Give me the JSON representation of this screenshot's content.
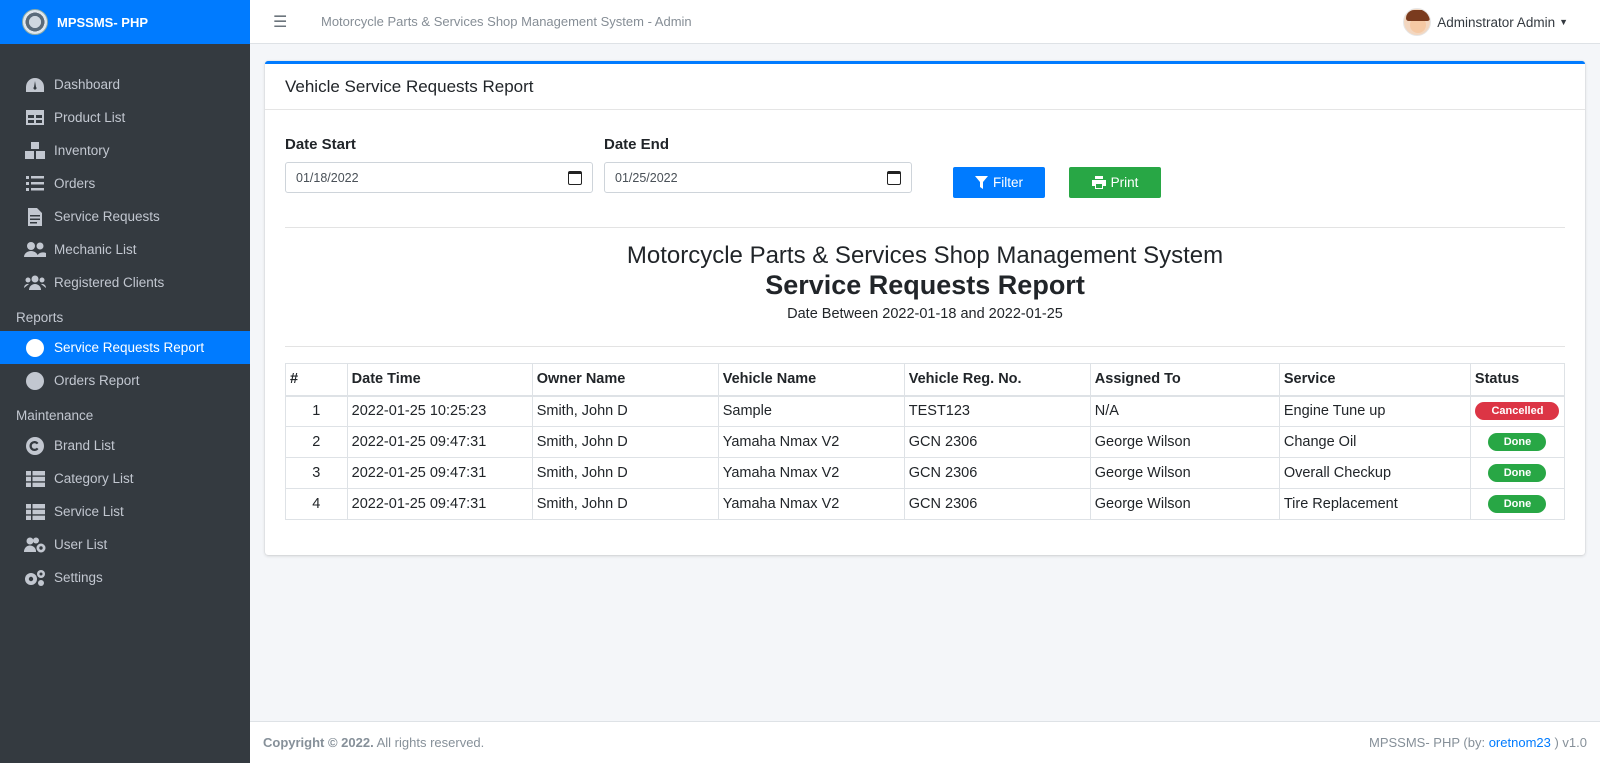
{
  "brand": {
    "name": "MPSSMS- PHP"
  },
  "topbar": {
    "title": "Motorcycle Parts & Services Shop Management System - Admin",
    "user_name": "Adminstrator Admin"
  },
  "sidebar": {
    "items": [
      {
        "label": "Dashboard",
        "icon": "dashboard-icon"
      },
      {
        "label": "Product List",
        "icon": "table-icon"
      },
      {
        "label": "Inventory",
        "icon": "boxes-icon"
      },
      {
        "label": "Orders",
        "icon": "list-check-icon"
      },
      {
        "label": "Service Requests",
        "icon": "file-icon"
      }
    ],
    "items2": [
      {
        "label": "Mechanic List",
        "icon": "users-icon"
      },
      {
        "label": "Registered Clients",
        "icon": "users-group-icon"
      }
    ],
    "reports_header": "Reports",
    "reports": [
      {
        "label": "Service Requests Report"
      },
      {
        "label": "Orders Report"
      }
    ],
    "maintenance_header": "Maintenance",
    "maintenance": [
      {
        "label": "Brand List",
        "icon": "copyright-icon"
      },
      {
        "label": "Category List",
        "icon": "th-list-icon"
      },
      {
        "label": "Service List",
        "icon": "th-list-icon"
      },
      {
        "label": "User List",
        "icon": "users-cog-icon"
      },
      {
        "label": "Settings",
        "icon": "cogs-icon"
      }
    ]
  },
  "card": {
    "title": "Vehicle Service Requests Report",
    "date_start_label": "Date Start",
    "date_start_value": "01/18/2022",
    "date_end_label": "Date End",
    "date_end_value": "01/25/2022",
    "filter_label": "Filter",
    "print_label": "Print"
  },
  "report": {
    "system_name": "Motorcycle Parts & Services Shop Management System",
    "title": "Service Requests Report",
    "range": "Date Between 2022-01-18 and 2022-01-25"
  },
  "table": {
    "headers": [
      "#",
      "Date Time",
      "Owner Name",
      "Vehicle Name",
      "Vehicle Reg. No.",
      "Assigned To",
      "Service",
      "Status"
    ],
    "rows": [
      [
        "1",
        "2022-01-25 10:25:23",
        "Smith, John D",
        "Sample",
        "TEST123",
        "N/A",
        "Engine Tune up",
        "Cancelled"
      ],
      [
        "2",
        "2022-01-25 09:47:31",
        "Smith, John D",
        "Yamaha Nmax V2",
        "GCN 2306",
        "George Wilson",
        "Change Oil",
        "Done"
      ],
      [
        "3",
        "2022-01-25 09:47:31",
        "Smith, John D",
        "Yamaha Nmax V2",
        "GCN 2306",
        "George Wilson",
        "Overall Checkup",
        "Done"
      ],
      [
        "4",
        "2022-01-25 09:47:31",
        "Smith, John D",
        "Yamaha Nmax V2",
        "GCN 2306",
        "George Wilson",
        "Tire Replacement",
        "Done"
      ]
    ]
  },
  "footer": {
    "copyright_prefix": "Copyright © 2022.",
    "copyright_suffix": "All rights reserved.",
    "credit_prefix": "MPSSMS- PHP (by:",
    "credit_author": "oretnom23",
    "credit_suffix": ") v1.0"
  },
  "colors": {
    "primary": "#007bff",
    "success": "#28a745",
    "danger": "#dc3545",
    "sidebar_bg": "#343a40"
  }
}
